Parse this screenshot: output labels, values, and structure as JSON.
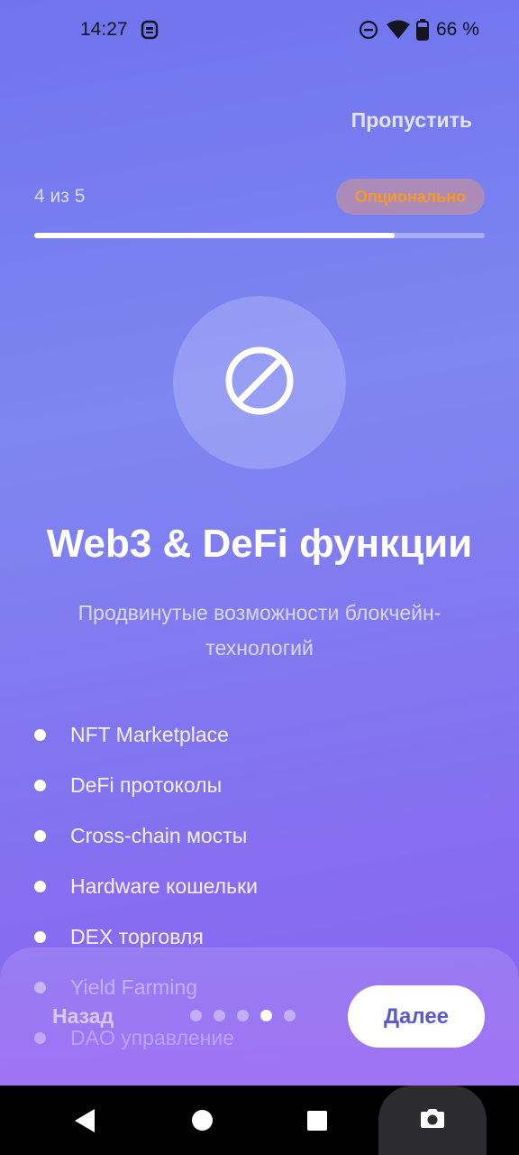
{
  "status_bar": {
    "time": "14:27",
    "battery": "66 %",
    "icons": [
      "app-notification-icon",
      "do-not-disturb-icon",
      "wifi-icon",
      "battery-icon"
    ]
  },
  "header": {
    "skip_label": "Пропустить",
    "step_counter": "4 из 5",
    "optional_badge": "Опционально",
    "progress_fraction": 0.8
  },
  "hero": {
    "icon": "block-icon"
  },
  "content": {
    "title": "Web3 & DeFi функции",
    "subtitle": "Продвинутые возможности блокчейн-технологий",
    "features": [
      "NFT Marketplace",
      "DeFi протоколы",
      "Cross-chain мосты",
      "Hardware кошельки",
      "DEX торговля",
      "Yield Farming",
      "DAO управление"
    ]
  },
  "footer": {
    "back_label": "Назад",
    "next_label": "Далее",
    "page_count": 5,
    "active_page": 4
  },
  "nav_bar": {
    "icons": [
      "back-icon",
      "home-icon",
      "recents-icon",
      "camera-icon"
    ]
  },
  "colors": {
    "accent": "#5a5ad0",
    "badge_text": "#f39a2a",
    "background_top": "#6f73ee",
    "background_bottom": "#8e5ef0"
  }
}
